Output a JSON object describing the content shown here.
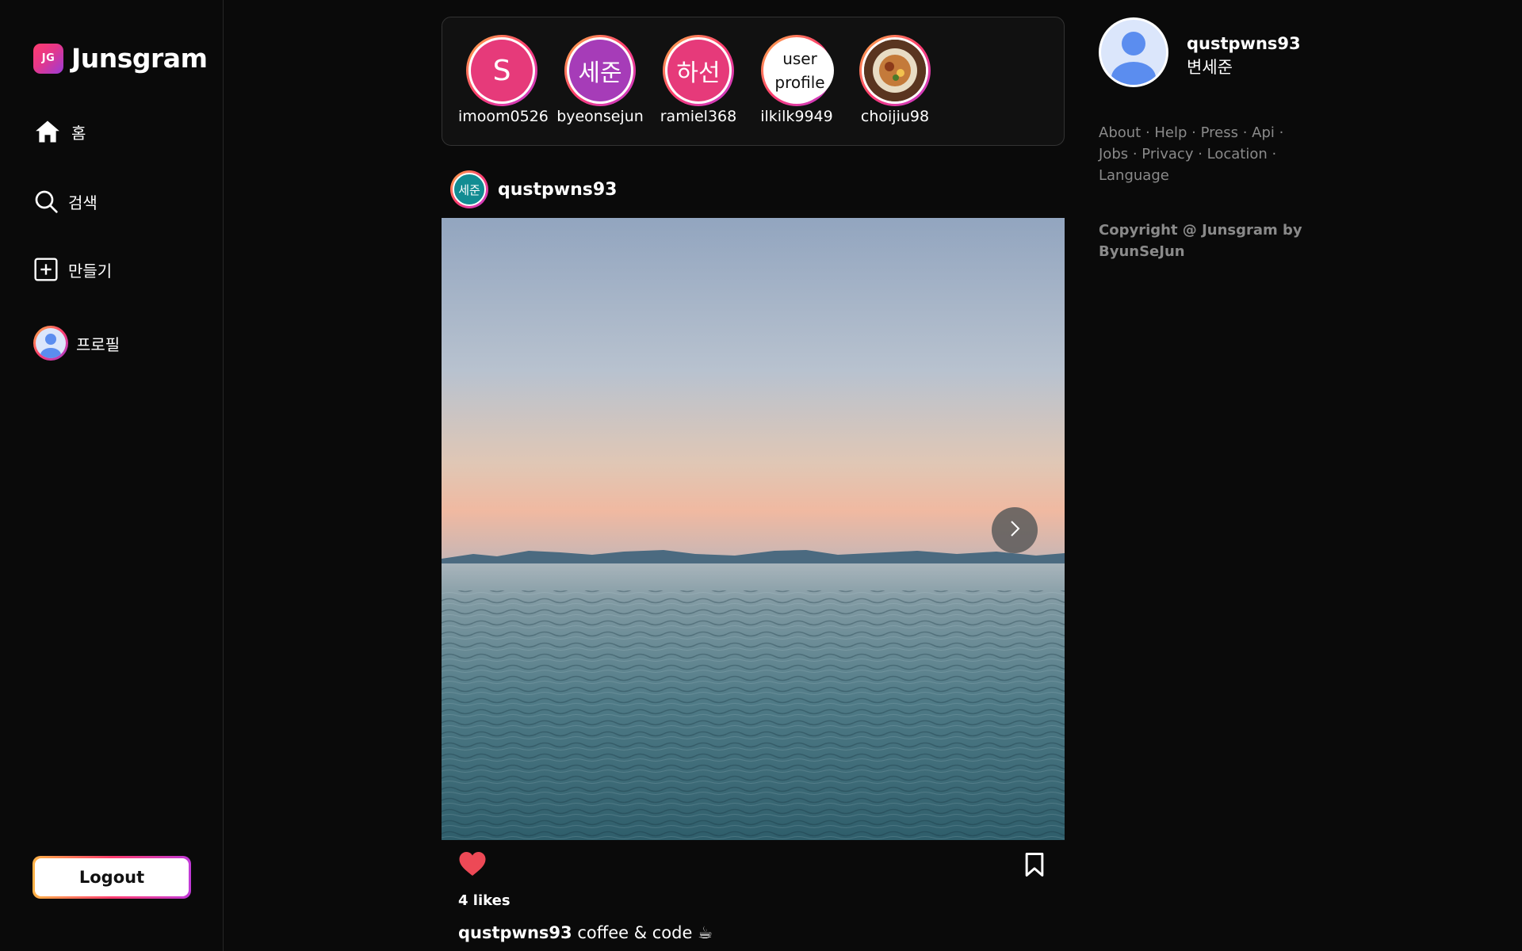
{
  "brand": {
    "badge": "JG",
    "name": "Junsgram"
  },
  "nav": {
    "home": "홈",
    "search": "검색",
    "create": "만들기",
    "profile": "프로필"
  },
  "logout_label": "Logout",
  "stories": [
    {
      "username": "imoom0526",
      "avatar_text": "S",
      "color": "#e63a7a"
    },
    {
      "username": "byeonsejun",
      "avatar_text": "세준",
      "color": "#a63cb8"
    },
    {
      "username": "ramiel368",
      "avatar_text": "하선",
      "color": "#e63a7a"
    },
    {
      "username": "ilkilk9949",
      "avatar_text": "user profile",
      "color": "#ffffff"
    },
    {
      "username": "choijiu98",
      "avatar_text": "",
      "color": "#7a4a2a"
    }
  ],
  "post": {
    "username": "qustpwns93",
    "avatar_text": "세준",
    "likes": "4 likes",
    "caption_user": "qustpwns93",
    "caption_text": "coffee & code ☕"
  },
  "me": {
    "username": "qustpwns93",
    "name": "변세준"
  },
  "footer": {
    "links": [
      "About",
      "Help",
      "Press",
      "Api",
      "Jobs",
      "Privacy",
      "Location",
      "Language"
    ],
    "copyright": "Copyright @ Junsgram by ByunSeJun"
  }
}
